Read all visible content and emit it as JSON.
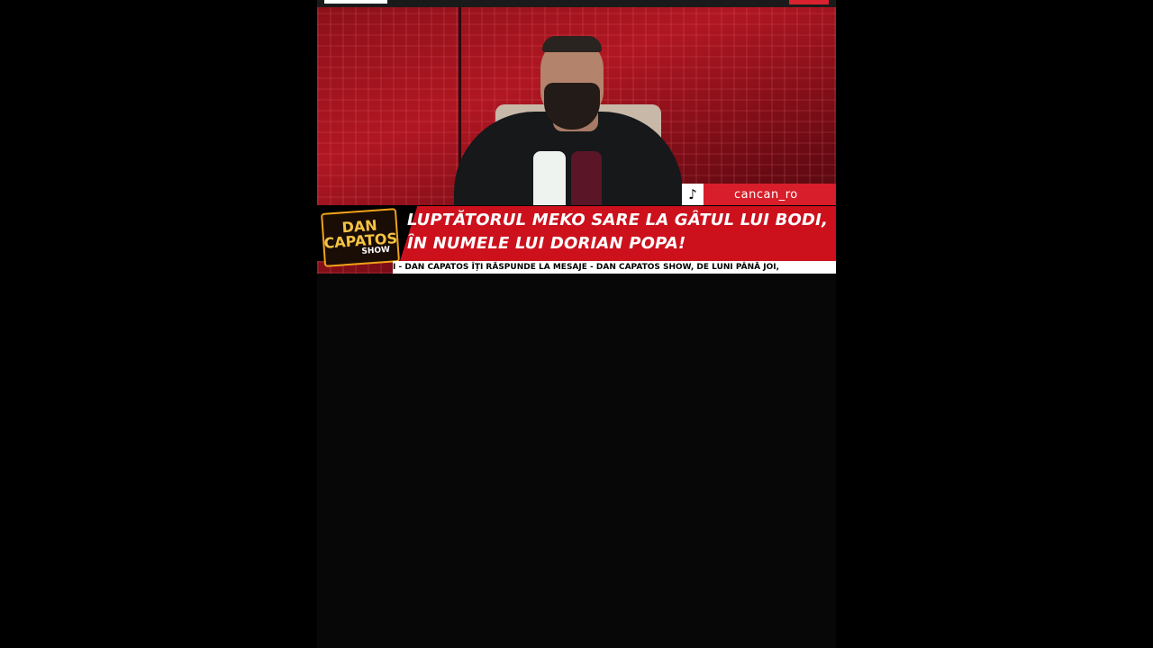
{
  "video": {
    "tiktok_handle": "cancan_ro",
    "tiktok_icon": "tiktok-icon",
    "logo": {
      "line1": "DAN",
      "line2": "CAPATOS",
      "line3": "SHOW"
    },
    "headline": "LUPTĂTORUL MEKO SARE LA GÂTUL LUI BODI, ÎN NUMELE LUI DORIAN POPA!",
    "ticker": "I - DAN CAPATOS ÎȚI RĂSPUNDE LA MESAJE - DAN CAPATOS SHOW, DE LUNI PÂNĂ JOI,"
  },
  "colors": {
    "accent_red": "#cc111d",
    "logo_gold": "#f0a21a",
    "background": "#000000"
  }
}
